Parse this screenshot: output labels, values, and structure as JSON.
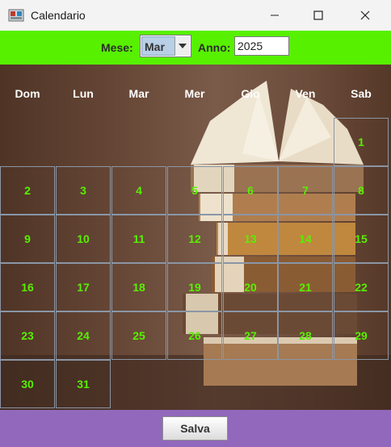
{
  "window": {
    "title": "Calendario",
    "controls": {
      "minimize": "minimize",
      "maximize": "maximize",
      "close": "close"
    }
  },
  "toolbar": {
    "month_label": "Mese:",
    "month_value": "Mar",
    "year_label": "Anno:",
    "year_value": "2025",
    "accent_color": "#57f000"
  },
  "calendar": {
    "weekdays": [
      "Dom",
      "Lun",
      "Mar",
      "Mer",
      "Gio",
      "Ven",
      "Sab"
    ],
    "day_color": "#58f000",
    "background_image": "stack-of-books",
    "first_weekday_index": 6,
    "days": [
      1,
      2,
      3,
      4,
      5,
      6,
      7,
      8,
      9,
      10,
      11,
      12,
      13,
      14,
      15,
      16,
      17,
      18,
      19,
      20,
      21,
      22,
      23,
      24,
      25,
      26,
      27,
      28,
      29,
      30,
      31
    ]
  },
  "footer": {
    "save_label": "Salva",
    "color": "#9168bb"
  }
}
